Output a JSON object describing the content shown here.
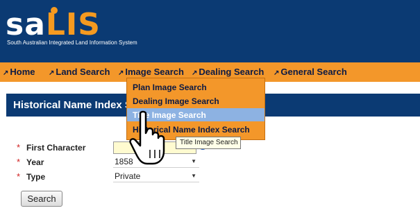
{
  "header": {
    "logo": {
      "part1": "sa",
      "part2": "LIS"
    },
    "tagline": "South Australian Integrated Land Information System"
  },
  "nav": [
    {
      "label": "Home"
    },
    {
      "label": "Land Search"
    },
    {
      "label": "Image Search"
    },
    {
      "label": "Dealing Search"
    },
    {
      "label": "General Search"
    }
  ],
  "dropdown": {
    "items": [
      {
        "label": "Plan Image Search"
      },
      {
        "label": "Dealing Image Search"
      },
      {
        "label": "Title Image Search"
      },
      {
        "label": "Historical Name Index Search"
      }
    ],
    "highlighted_index": 2
  },
  "page": {
    "title": "Historical Name Index Search"
  },
  "form": {
    "required_marker": "*",
    "first_character": {
      "label": "First Character",
      "value": ""
    },
    "year": {
      "label": "Year",
      "value": "1858"
    },
    "type": {
      "label": "Type",
      "value": "Private"
    },
    "search_button": "Search"
  },
  "tooltip": "Title Image Search",
  "colors": {
    "header": "#0b3a73",
    "nav": "#f3972a",
    "highlight": "#8db2e2",
    "required": "#d02020"
  }
}
